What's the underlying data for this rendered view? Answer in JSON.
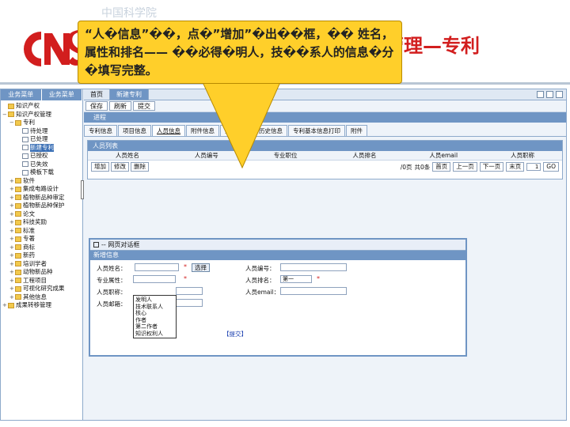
{
  "org_name": "中国科学院",
  "slide_title": "知识产权管理—专利",
  "callout": {
    "text": "“人�信息”��，点�”增加”�出��框，�� 姓名，属性和排名—— ��必得�明人，技��系人的信息�分�填写完整。"
  },
  "sidebar": {
    "tabs": [
      "业务菜单",
      "业务菜单"
    ],
    "items": [
      {
        "label": "知识产权",
        "level": 0,
        "pm": "",
        "icon": "folder"
      },
      {
        "label": "知识产权管理",
        "level": 0,
        "pm": "−",
        "icon": "folder"
      },
      {
        "label": "专利",
        "level": 1,
        "pm": "−",
        "icon": "folder"
      },
      {
        "label": "待处理",
        "level": 2,
        "pm": "",
        "icon": "doc"
      },
      {
        "label": "已处理",
        "level": 2,
        "pm": "",
        "icon": "doc"
      },
      {
        "label": "新建专利",
        "level": 2,
        "pm": "",
        "icon": "doc",
        "selected": true
      },
      {
        "label": "已授权",
        "level": 2,
        "pm": "",
        "icon": "doc"
      },
      {
        "label": "已失效",
        "level": 2,
        "pm": "",
        "icon": "doc"
      },
      {
        "label": "模板下载",
        "level": 2,
        "pm": "",
        "icon": "doc"
      },
      {
        "label": "软件",
        "level": 1,
        "pm": "+",
        "icon": "folder"
      },
      {
        "label": "集成电路设计",
        "level": 1,
        "pm": "+",
        "icon": "folder"
      },
      {
        "label": "植物新品种审定",
        "level": 1,
        "pm": "+",
        "icon": "folder"
      },
      {
        "label": "植物新品种保护",
        "level": 1,
        "pm": "+",
        "icon": "folder"
      },
      {
        "label": "论文",
        "level": 1,
        "pm": "+",
        "icon": "folder"
      },
      {
        "label": "科技奖励",
        "level": 1,
        "pm": "+",
        "icon": "folder"
      },
      {
        "label": "标准",
        "level": 1,
        "pm": "+",
        "icon": "folder"
      },
      {
        "label": "专著",
        "level": 1,
        "pm": "+",
        "icon": "folder"
      },
      {
        "label": "商标",
        "level": 1,
        "pm": "+",
        "icon": "folder"
      },
      {
        "label": "新药",
        "level": 1,
        "pm": "+",
        "icon": "folder"
      },
      {
        "label": "培训学者",
        "level": 1,
        "pm": "+",
        "icon": "folder"
      },
      {
        "label": "动物新品种",
        "level": 1,
        "pm": "+",
        "icon": "folder"
      },
      {
        "label": "工程项目",
        "level": 1,
        "pm": "+",
        "icon": "folder"
      },
      {
        "label": "可视化研究成果",
        "level": 1,
        "pm": "+",
        "icon": "folder"
      },
      {
        "label": "其他信息",
        "level": 1,
        "pm": "+",
        "icon": "folder"
      },
      {
        "label": "成果转移管理",
        "level": 0,
        "pm": "+",
        "icon": "folder"
      }
    ]
  },
  "main": {
    "top_tabs": [
      "首页",
      "新建专利"
    ],
    "toolbar": [
      "保存",
      "刷新",
      "提交"
    ],
    "section_title": "进程",
    "sub_tabs": [
      "专利信息",
      "项目信息",
      "人员信息",
      "附件信息",
      "费用信息",
      "历史信息",
      "专利基本信息打印",
      "附件"
    ],
    "active_sub_tab": 2,
    "grid": {
      "title": "人员列表",
      "columns": [
        "人员姓名",
        "人员编号",
        "专业职位",
        "人员排名",
        "人员email",
        "人员职称"
      ],
      "buttons": [
        "增加",
        "修改",
        "删除"
      ],
      "pager": {
        "info": "/0页",
        "total": "共0条",
        "first": "首页",
        "prev": "上一页",
        "next": "下一页",
        "last": "末页",
        "page": "1",
        "go": "GO"
      }
    }
  },
  "dialog": {
    "title": "-- 网页对话框",
    "subtitle": "新增信息",
    "fields": {
      "name_label": "人员姓名：",
      "select_button": "选择",
      "number_label": "人员编号：",
      "attr_label": "专业属性：",
      "rank_label": "人员排名：",
      "rank_value": "第一",
      "title_label": "人员职称：",
      "email_label": "人员email：",
      "order_label": "人员邮箱："
    },
    "dropdown_options": [
      "发明人",
      "技术联系人",
      "核心",
      "作者",
      "第二作者",
      "知识权利人"
    ],
    "submit_label": "【提交】"
  },
  "colors": {
    "accent": "#6f95c4",
    "title_red": "#d21e1e",
    "callout": "#ffcf2a"
  }
}
